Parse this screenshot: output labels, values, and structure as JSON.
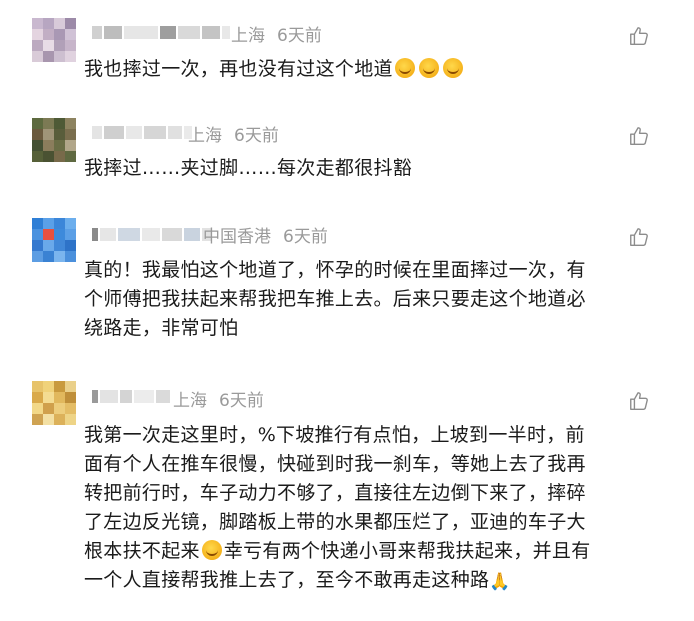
{
  "comments": [
    {
      "location": "上海",
      "time": "6天前",
      "text": "我也摔过一次，再也没有过这个地道",
      "emoji_after": [
        "laughing-crying-emoji",
        "laughing-crying-emoji",
        "laughing-crying-emoji"
      ]
    },
    {
      "location": "上海",
      "time": "6天前",
      "text": "我摔过……夹过脚……每次走都很抖豁"
    },
    {
      "location": "中国香港",
      "time": "6天前",
      "lines": [
        "真的！我最怕这个地道了，怀孕的时候在里面摔过一次，有",
        "个师傅把我扶起来帮我把车推上去。后来只要走这个地道必",
        "绕路走，非常可怕"
      ]
    },
    {
      "location": "上海",
      "time": "6天前",
      "lines": [
        "我第一次走这里时，%下坡推行有点怕，上坡到一半时，前",
        "面有个人在推车很慢，快碰到时我一刹车，等她上去了我再",
        "转把前行时，车子动力不够了，直接往左边倒下来了，摔碎",
        "了左边反光镜，脚踏板上带的水果都压烂了，亚迪的车子大"
      ],
      "line5_a": "根本扶不起来",
      "line5_b": "幸亏有两个快递小哥来帮我扶起来，并且有",
      "line6": "一个人直接帮我推上去了，至今不敢再走这种路"
    }
  ],
  "icons": {
    "like": "thumbs-up-icon",
    "emoji": "laughing-crying-emoji",
    "pray": "praying-hands-emoji"
  },
  "colors": {
    "meta": "#9a9a9a",
    "body_text": "#1b1b1b",
    "icon": "#8c8c8c"
  }
}
